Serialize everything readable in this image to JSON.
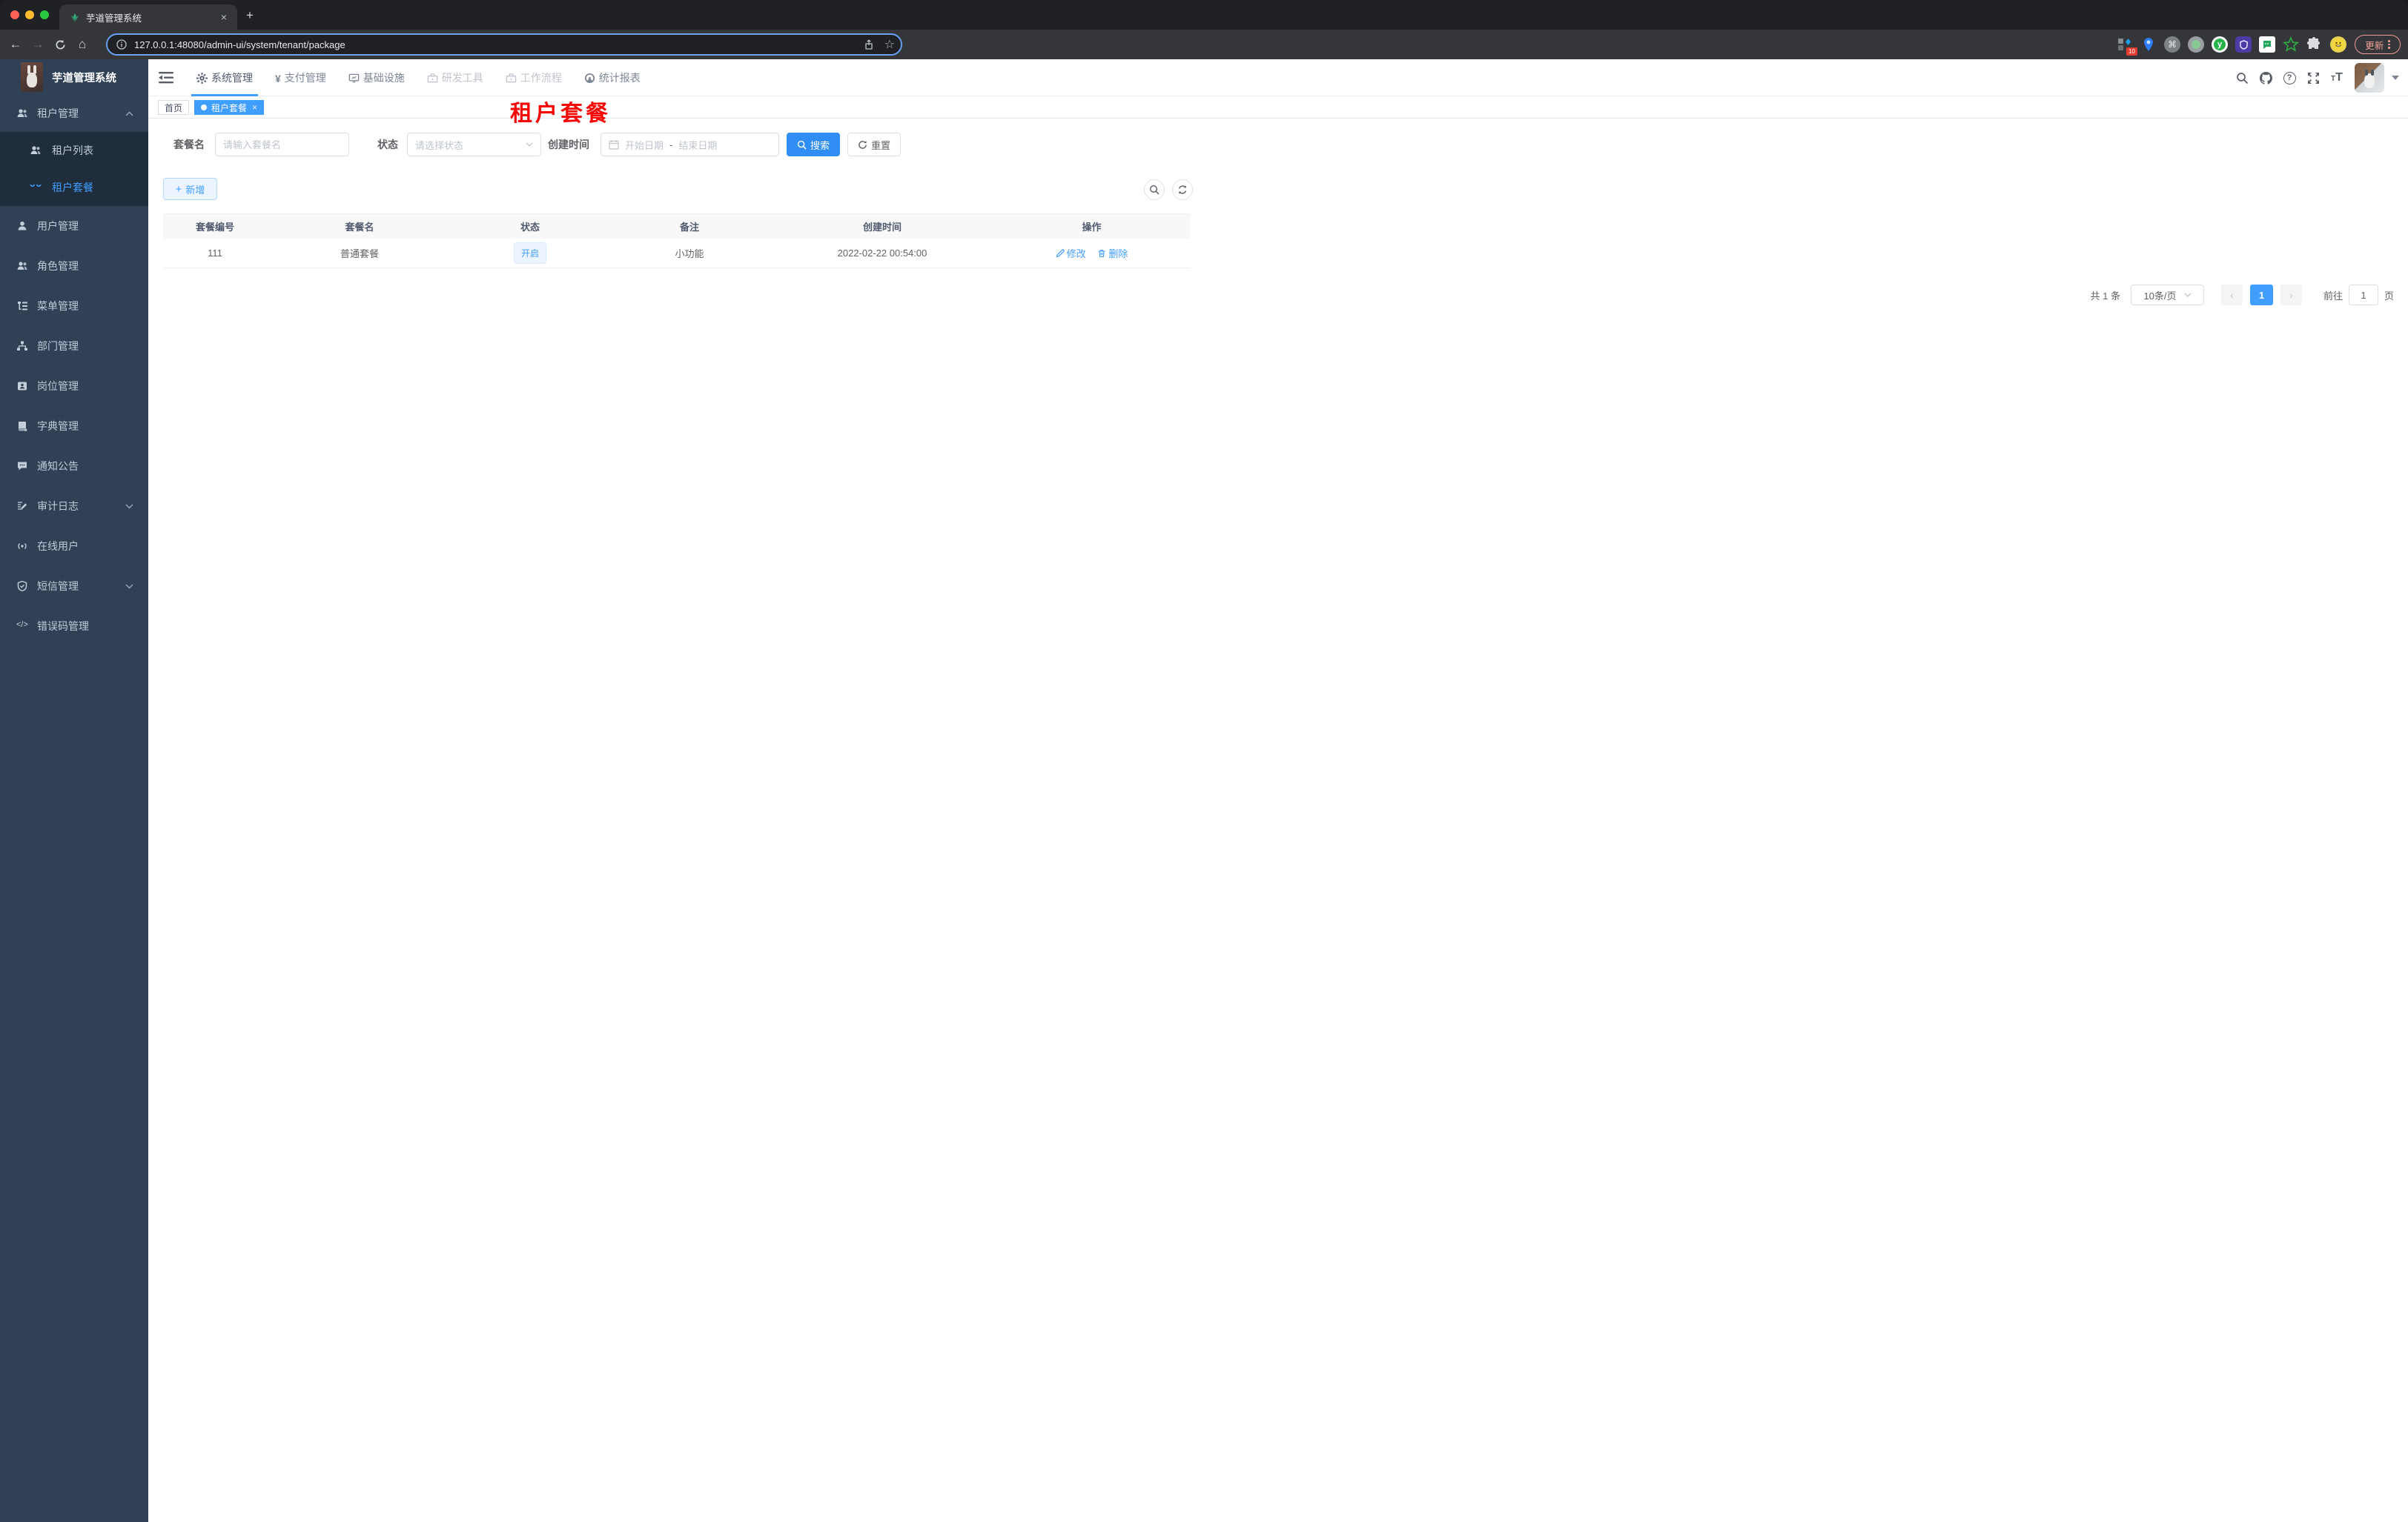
{
  "colors": {
    "accent": "#409eff",
    "sidebar_bg": "#304156",
    "sidebar_submenu_bg": "#1f2d3d",
    "title_red": "#f70606",
    "status_tag_bg": "#ecf5ff"
  },
  "browser": {
    "tab": {
      "title": "芋道管理系统",
      "close_glyph": "×",
      "new_tab_glyph": "+"
    },
    "toolbar": {
      "back_glyph": "←",
      "forward_glyph": "→",
      "home_glyph": "⌂"
    },
    "address": {
      "url": "127.0.0.1:48080/admin-ui/system/tenant/package",
      "star_glyph": "☆"
    },
    "extensions": {
      "badge_count": "10",
      "cmd_glyph": "⌘",
      "y_glyph": "y"
    },
    "update_button": "更新"
  },
  "header": {
    "logo_title": "芋道管理系统",
    "nav": [
      {
        "label": "系统管理"
      },
      {
        "label": "支付管理",
        "glyph": "¥"
      },
      {
        "label": "基础设施"
      },
      {
        "label": "研发工具"
      },
      {
        "label": "工作流程"
      },
      {
        "label": "统计报表"
      }
    ]
  },
  "sidebar": {
    "items": [
      {
        "label": "租户管理"
      },
      {
        "label": "租户列表"
      },
      {
        "label": "租户套餐"
      },
      {
        "label": "用户管理"
      },
      {
        "label": "角色管理"
      },
      {
        "label": "菜单管理"
      },
      {
        "label": "部门管理"
      },
      {
        "label": "岗位管理"
      },
      {
        "label": "字典管理"
      },
      {
        "label": "通知公告"
      },
      {
        "label": "审计日志"
      },
      {
        "label": "在线用户"
      },
      {
        "label": "短信管理"
      },
      {
        "label": "错误码管理",
        "glyph": "</>"
      }
    ]
  },
  "tags": {
    "home": "首页",
    "active": "租户套餐",
    "close_glyph": "×"
  },
  "page": {
    "title": "租户套餐",
    "filters": {
      "name_label": "套餐名",
      "name_placeholder": "请输入套餐名",
      "status_label": "状态",
      "status_placeholder": "请选择状态",
      "date_label": "创建时间",
      "date_start_placeholder": "开始日期",
      "date_separator": "-",
      "date_end_placeholder": "结束日期",
      "search_button": "搜索",
      "reset_button": "重置"
    },
    "toolbar": {
      "add_button": "新增",
      "add_glyph": "+"
    },
    "table": {
      "headers": [
        "套餐编号",
        "套餐名",
        "状态",
        "备注",
        "创建时间",
        "操作"
      ],
      "rows": [
        {
          "id": "111",
          "name": "普通套餐",
          "status": "开启",
          "remark": "小功能",
          "created": "2022-02-22 00:54:00",
          "edit": "修改",
          "delete": "删除"
        }
      ]
    },
    "pagination": {
      "total": "共 1 条",
      "page_size": "10条/页",
      "prev_glyph": "‹",
      "next_glyph": "›",
      "current_page": "1",
      "goto_label": "前往",
      "goto_value": "1",
      "page_suffix": "页"
    }
  }
}
